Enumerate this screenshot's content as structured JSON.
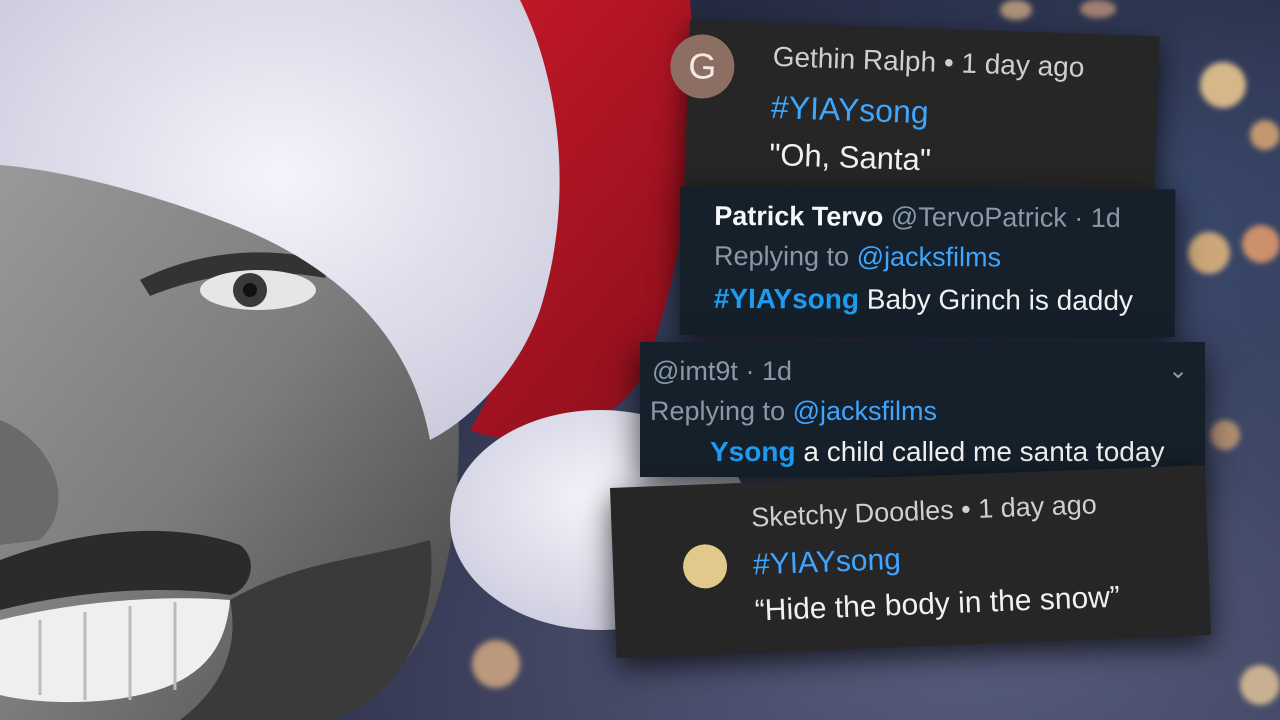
{
  "comments": [
    {
      "platform": "youtube",
      "avatar_letter": "G",
      "avatar_color": "#8d6e63",
      "author": "Gethin Ralph",
      "time": "1 day ago",
      "hashtag": "#YIAYsong",
      "text": "\"Oh, Santa\""
    },
    {
      "platform": "twitter",
      "display_name": "Patrick Tervo",
      "handle": "@TervoPatrick",
      "time": "1d",
      "replying_label": "Replying to",
      "replying_handle": "@jacksfilms",
      "hashtag": "#YIAYsong",
      "text": "Baby Grinch is daddy"
    },
    {
      "platform": "twitter",
      "handle": "@imt9t",
      "time": "1d",
      "replying_label": "Replying to",
      "replying_handle": "@jacksfilms",
      "hashtag_partial": "Ysong",
      "text": "a child called me santa today"
    },
    {
      "platform": "youtube",
      "author": "Sketchy Doodles",
      "time": "1 day ago",
      "hashtag": "#YIAYsong",
      "text": "“Hide the body in the snow”"
    }
  ],
  "colors": {
    "youtube_card": "#262626",
    "twitter_card": "#15202b",
    "hashtag_blue": "#3ea6ff",
    "hat_red": "#c8102e",
    "hat_fur": "#e8e8f4"
  }
}
